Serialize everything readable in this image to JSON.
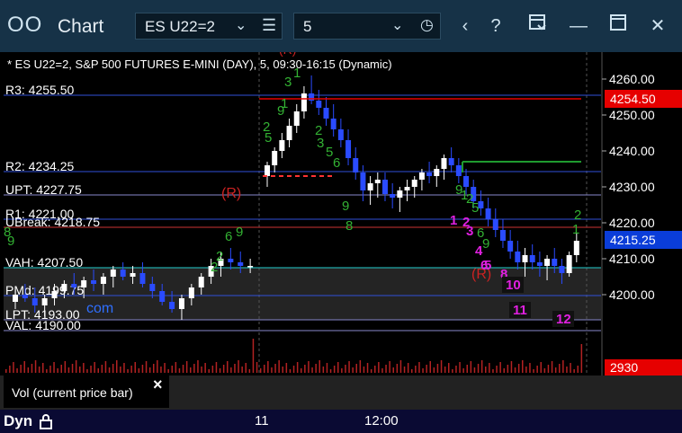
{
  "window": {
    "app_icon": "OO",
    "title": "Chart",
    "symbol": "ES U22=2",
    "interval": "5",
    "buttons": [
      "chevron-down-icon",
      "menu-icon",
      "clock-icon",
      "chevron-left-icon",
      "help-icon",
      "window-settings-icon",
      "minimize-icon",
      "maximize-icon",
      "close-icon"
    ]
  },
  "header_text": "* ES U22=2, S&P 500 FUTURES E-MINI (DAY), 5, 09:30-16:15 (Dynamic)",
  "price_axis": {
    "ticks": [
      "4260.00",
      "4250.00",
      "4240.00",
      "4230.00",
      "4220.00",
      "4210.00",
      "4200.00"
    ],
    "tick_values": [
      4260,
      4250,
      4240,
      4230,
      4220,
      4210,
      4200
    ],
    "current_price": "4215.25",
    "current_value": 4215.25,
    "level_tag": "4254.50",
    "level_tag_value": 4254.5,
    "current_color": "#0a3dd9",
    "level_color": "#e60000"
  },
  "levels": [
    {
      "label": "R3: 4255.50",
      "value": 4255.5,
      "color": "#2f4fd8"
    },
    {
      "label": "R2: 4234.25",
      "value": 4234.25,
      "color": "#2f4fd8"
    },
    {
      "label": "UPT: 4227.75",
      "value": 4227.75,
      "color": "#8888cc"
    },
    {
      "label": "R1: 4221.00",
      "value": 4221.0,
      "color": "#2f4fd8"
    },
    {
      "label": "UBreak: 4218.75",
      "value": 4218.75,
      "color": "#cc3333"
    },
    {
      "label": "VAH: 4207.50",
      "value": 4207.5,
      "color": "#22cccc"
    },
    {
      "label": "PMd: 4199.75",
      "value": 4199.75,
      "color": "#2f4fd8"
    },
    {
      "label": "LPT: 4193.00",
      "value": 4193.0,
      "color": "#8888cc"
    },
    {
      "label": "VAL: 4190.00",
      "value": 4190.0,
      "color": "#8888cc"
    }
  ],
  "annotations": {
    "r_marker": "(R)",
    "lower_marker": "(R)",
    "com_text": "com",
    "green_counts": [
      "8",
      "9",
      "6",
      "9",
      "2",
      "2",
      "3",
      "1",
      "2",
      "5",
      "9",
      "1",
      "2",
      "3",
      "5",
      "6",
      "9",
      "8",
      "9",
      "1",
      "2",
      "5",
      "6",
      "9",
      "2",
      "1"
    ],
    "magenta_counts": [
      "1",
      "2",
      "3",
      "4",
      "5",
      "6",
      "8",
      "10",
      "11",
      "12"
    ]
  },
  "volume": {
    "label": "Vol (current price bar)",
    "close_icon": "×",
    "value": "2930",
    "value_color": "#e60000"
  },
  "time_axis": {
    "labels": [
      "11",
      "12:00"
    ],
    "mode": "Dyn",
    "lock_icon": "lock-icon"
  },
  "chart_data": {
    "type": "candlestick",
    "symbol": "ES U22=2",
    "interval": "5",
    "ylim": [
      4193,
      4265
    ],
    "yticks": [
      4200,
      4210,
      4220,
      4230,
      4240,
      4250,
      4260
    ],
    "bars": [
      {
        "o": 4198,
        "h": 4201,
        "l": 4196,
        "c": 4200
      },
      {
        "o": 4200,
        "h": 4203,
        "l": 4198,
        "c": 4199
      },
      {
        "o": 4199,
        "h": 4202,
        "l": 4195,
        "c": 4197
      },
      {
        "o": 4197,
        "h": 4200,
        "l": 4194,
        "c": 4199
      },
      {
        "o": 4199,
        "h": 4203,
        "l": 4197,
        "c": 4201
      },
      {
        "o": 4201,
        "h": 4204,
        "l": 4199,
        "c": 4203
      },
      {
        "o": 4203,
        "h": 4206,
        "l": 4200,
        "c": 4202
      },
      {
        "o": 4202,
        "h": 4205,
        "l": 4199,
        "c": 4204
      },
      {
        "o": 4204,
        "h": 4207,
        "l": 4201,
        "c": 4203
      },
      {
        "o": 4203,
        "h": 4206,
        "l": 4200,
        "c": 4205
      },
      {
        "o": 4205,
        "h": 4208,
        "l": 4202,
        "c": 4207
      },
      {
        "o": 4207,
        "h": 4209,
        "l": 4204,
        "c": 4205
      },
      {
        "o": 4205,
        "h": 4208,
        "l": 4203,
        "c": 4206
      },
      {
        "o": 4206,
        "h": 4209,
        "l": 4202,
        "c": 4203
      },
      {
        "o": 4203,
        "h": 4205,
        "l": 4199,
        "c": 4201
      },
      {
        "o": 4201,
        "h": 4203,
        "l": 4197,
        "c": 4198
      },
      {
        "o": 4198,
        "h": 4201,
        "l": 4195,
        "c": 4196
      },
      {
        "o": 4196,
        "h": 4200,
        "l": 4193,
        "c": 4199
      },
      {
        "o": 4199,
        "h": 4203,
        "l": 4197,
        "c": 4202
      },
      {
        "o": 4202,
        "h": 4206,
        "l": 4200,
        "c": 4205
      },
      {
        "o": 4205,
        "h": 4210,
        "l": 4203,
        "c": 4208
      },
      {
        "o": 4208,
        "h": 4212,
        "l": 4205,
        "c": 4210
      },
      {
        "o": 4210,
        "h": 4213,
        "l": 4207,
        "c": 4209
      },
      {
        "o": 4209,
        "h": 4212,
        "l": 4206,
        "c": 4208
      },
      {
        "o": 4208,
        "h": 4210,
        "l": 4206,
        "c": 4208
      },
      {
        "o": 4233,
        "h": 4237,
        "l": 4230,
        "c": 4236
      },
      {
        "o": 4236,
        "h": 4241,
        "l": 4234,
        "c": 4240
      },
      {
        "o": 4240,
        "h": 4245,
        "l": 4238,
        "c": 4243
      },
      {
        "o": 4243,
        "h": 4249,
        "l": 4241,
        "c": 4247
      },
      {
        "o": 4247,
        "h": 4253,
        "l": 4245,
        "c": 4251
      },
      {
        "o": 4251,
        "h": 4258,
        "l": 4249,
        "c": 4256
      },
      {
        "o": 4256,
        "h": 4261,
        "l": 4253,
        "c": 4254
      },
      {
        "o": 4254,
        "h": 4257,
        "l": 4250,
        "c": 4252
      },
      {
        "o": 4252,
        "h": 4255,
        "l": 4247,
        "c": 4249
      },
      {
        "o": 4249,
        "h": 4253,
        "l": 4244,
        "c": 4246
      },
      {
        "o": 4246,
        "h": 4249,
        "l": 4241,
        "c": 4243
      },
      {
        "o": 4243,
        "h": 4246,
        "l": 4236,
        "c": 4238
      },
      {
        "o": 4238,
        "h": 4241,
        "l": 4232,
        "c": 4234
      },
      {
        "o": 4234,
        "h": 4236,
        "l": 4226,
        "c": 4229
      },
      {
        "o": 4229,
        "h": 4233,
        "l": 4225,
        "c": 4231
      },
      {
        "o": 4231,
        "h": 4234,
        "l": 4227,
        "c": 4232
      },
      {
        "o": 4232,
        "h": 4234,
        "l": 4226,
        "c": 4228
      },
      {
        "o": 4228,
        "h": 4231,
        "l": 4224,
        "c": 4227
      },
      {
        "o": 4227,
        "h": 4230,
        "l": 4223,
        "c": 4229
      },
      {
        "o": 4229,
        "h": 4232,
        "l": 4226,
        "c": 4230
      },
      {
        "o": 4230,
        "h": 4233,
        "l": 4227,
        "c": 4232
      },
      {
        "o": 4232,
        "h": 4235,
        "l": 4229,
        "c": 4234
      },
      {
        "o": 4234,
        "h": 4237,
        "l": 4231,
        "c": 4233
      },
      {
        "o": 4233,
        "h": 4236,
        "l": 4230,
        "c": 4235
      },
      {
        "o": 4235,
        "h": 4239,
        "l": 4232,
        "c": 4238
      },
      {
        "o": 4238,
        "h": 4241,
        "l": 4234,
        "c": 4236
      },
      {
        "o": 4236,
        "h": 4238,
        "l": 4231,
        "c": 4233
      },
      {
        "o": 4233,
        "h": 4235,
        "l": 4228,
        "c": 4230
      },
      {
        "o": 4230,
        "h": 4232,
        "l": 4224,
        "c": 4226
      },
      {
        "o": 4226,
        "h": 4229,
        "l": 4222,
        "c": 4224
      },
      {
        "o": 4224,
        "h": 4227,
        "l": 4219,
        "c": 4221
      },
      {
        "o": 4221,
        "h": 4224,
        "l": 4216,
        "c": 4218
      },
      {
        "o": 4218,
        "h": 4221,
        "l": 4213,
        "c": 4215
      },
      {
        "o": 4215,
        "h": 4218,
        "l": 4210,
        "c": 4212
      },
      {
        "o": 4212,
        "h": 4215,
        "l": 4207,
        "c": 4209
      },
      {
        "o": 4209,
        "h": 4213,
        "l": 4205,
        "c": 4211
      },
      {
        "o": 4211,
        "h": 4214,
        "l": 4207,
        "c": 4209
      },
      {
        "o": 4209,
        "h": 4212,
        "l": 4205,
        "c": 4208
      },
      {
        "o": 4208,
        "h": 4211,
        "l": 4204,
        "c": 4210
      },
      {
        "o": 4210,
        "h": 4213,
        "l": 4206,
        "c": 4208
      },
      {
        "o": 4208,
        "h": 4210,
        "l": 4203,
        "c": 4206
      },
      {
        "o": 4206,
        "h": 4212,
        "l": 4205,
        "c": 4211
      },
      {
        "o": 4211,
        "h": 4217,
        "l": 4209,
        "c": 4215
      }
    ],
    "volume_value": 2930
  }
}
